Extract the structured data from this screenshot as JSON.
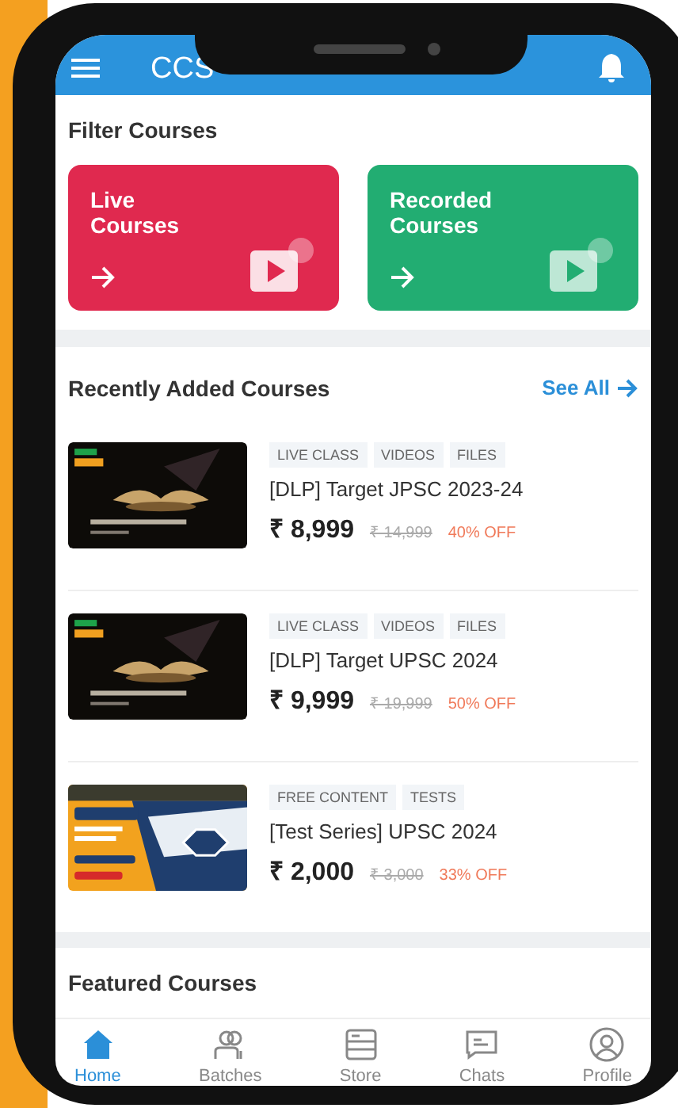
{
  "header": {
    "title": "CCS"
  },
  "filter": {
    "heading": "Filter Courses",
    "cards": [
      {
        "kind": "live",
        "line1": "Live",
        "line2": "Courses",
        "color": "#e0294f"
      },
      {
        "kind": "recorded",
        "line1": "Recorded",
        "line2": "Courses",
        "color": "#22ad72"
      }
    ]
  },
  "recent": {
    "heading": "Recently Added Courses",
    "see_all": "See All",
    "courses": [
      {
        "tags": [
          "LIVE CLASS",
          "VIDEOS",
          "FILES"
        ],
        "title": "[DLP] Target JPSC 2023-24",
        "price": "₹ 8,999",
        "old_price": "₹ 14,999",
        "discount": "40% OFF"
      },
      {
        "tags": [
          "LIVE CLASS",
          "VIDEOS",
          "FILES"
        ],
        "title": "[DLP] Target UPSC 2024",
        "price": "₹ 9,999",
        "old_price": "₹ 19,999",
        "discount": "50% OFF"
      },
      {
        "tags": [
          "FREE CONTENT",
          "TESTS"
        ],
        "title": "[Test Series] UPSC 2024",
        "price": "₹ 2,000",
        "old_price": "₹ 3,000",
        "discount": "33% OFF"
      }
    ]
  },
  "featured": {
    "heading": "Featured Courses"
  },
  "nav": [
    {
      "kind": "home",
      "label": "Home",
      "selected": true
    },
    {
      "kind": "batches",
      "label": "Batches",
      "selected": false
    },
    {
      "kind": "store",
      "label": "Store",
      "selected": false
    },
    {
      "kind": "chats",
      "label": "Chats",
      "selected": false
    },
    {
      "kind": "profile",
      "label": "Profile",
      "selected": false
    }
  ]
}
